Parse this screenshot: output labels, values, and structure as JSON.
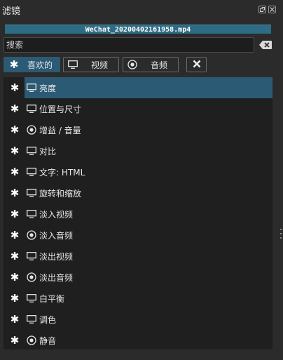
{
  "window": {
    "title": "滤镜",
    "float_icon": "float-icon",
    "close_icon": "close-icon"
  },
  "file_name": "WeChat_20200402161958.mp4",
  "search": {
    "placeholder": "搜索",
    "value": "",
    "clear_icon": "backspace-icon"
  },
  "tabs": [
    {
      "label": "喜欢的",
      "icon": "star-icon",
      "active": true
    },
    {
      "label": "视频",
      "icon": "monitor-icon",
      "active": false
    },
    {
      "label": "音频",
      "icon": "audio-disc-icon",
      "active": false
    }
  ],
  "close_filter_icon": "x-icon",
  "filters": [
    {
      "label": "亮度",
      "kind": "video",
      "selected": true
    },
    {
      "label": "位置与尺寸",
      "kind": "video",
      "selected": false
    },
    {
      "label": "增益 / 音量",
      "kind": "audio",
      "selected": false
    },
    {
      "label": "对比",
      "kind": "video",
      "selected": false
    },
    {
      "label": "文字: HTML",
      "kind": "video",
      "selected": false
    },
    {
      "label": "旋转和缩放",
      "kind": "video",
      "selected": false
    },
    {
      "label": "淡入视频",
      "kind": "video",
      "selected": false
    },
    {
      "label": "淡入音频",
      "kind": "audio",
      "selected": false
    },
    {
      "label": "淡出视频",
      "kind": "video",
      "selected": false
    },
    {
      "label": "淡出音频",
      "kind": "audio",
      "selected": false
    },
    {
      "label": "白平衡",
      "kind": "video",
      "selected": false
    },
    {
      "label": "调色",
      "kind": "video",
      "selected": false
    },
    {
      "label": "静音",
      "kind": "audio",
      "selected": false
    }
  ],
  "colors": {
    "accent": "#2a5a74",
    "file_bar": "#2e6b85",
    "panel_bg": "#2b2b2b",
    "list_bg": "#1f1f1f"
  }
}
